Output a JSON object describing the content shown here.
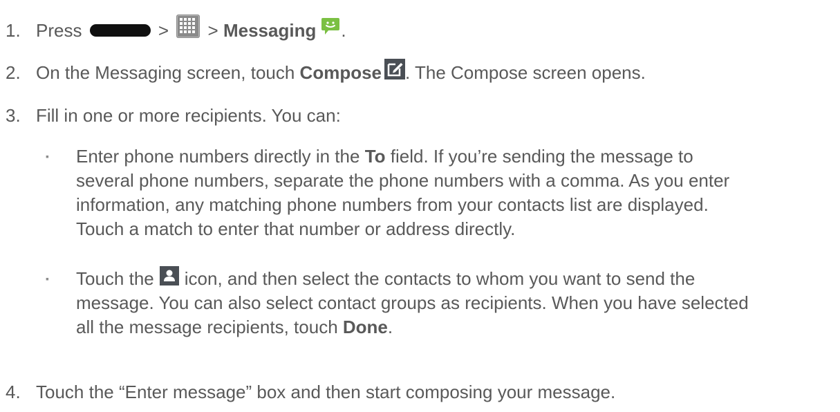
{
  "steps": [
    {
      "number": "1.",
      "text_a": "Press ",
      "sep_1": " > ",
      "sep_2": " > ",
      "bold": "Messaging",
      "text_end": "."
    },
    {
      "number": "2.",
      "text_a": "On the Messaging screen, touch ",
      "bold": "Compose",
      "text_b": ". The Compose screen opens."
    },
    {
      "number": "3.",
      "text": "Fill in one or more recipients. You can:"
    },
    {
      "number": "4.",
      "text": "Touch the “Enter message” box and then start composing your message."
    }
  ],
  "bullets": [
    {
      "mark": "▪",
      "line1_a": "Enter phone numbers directly in the ",
      "line1_bold": "To",
      "line1_b": " field. If you’re sending the message to",
      "line2": "several phone numbers, separate the phone numbers with a comma. As you enter",
      "line3": "information, any matching phone numbers from your contacts list are displayed.",
      "line4": "Touch a match to enter that number or address directly."
    },
    {
      "mark": "▪",
      "line1_a": "Touch the",
      "line1_b": "icon, and then select the contacts to whom you want to send the",
      "line2": "message. You can also select contact groups as recipients. When you have selected",
      "line3_a": "all the message recipients, touch ",
      "line3_bold": "Done",
      "line3_b": "."
    }
  ],
  "icons": {
    "home_key": "home-key-icon",
    "apps": "apps-grid-icon",
    "messaging": "messaging-icon",
    "compose": "compose-icon",
    "contacts": "contact-picker-icon"
  },
  "colors": {
    "text": "#595959",
    "home_key": "#101010",
    "apps_bg": "#8a8a8a",
    "messaging_green": "#7bc043",
    "compose_bg": "#4a4f55",
    "contact_bg": "#4a4f55"
  }
}
